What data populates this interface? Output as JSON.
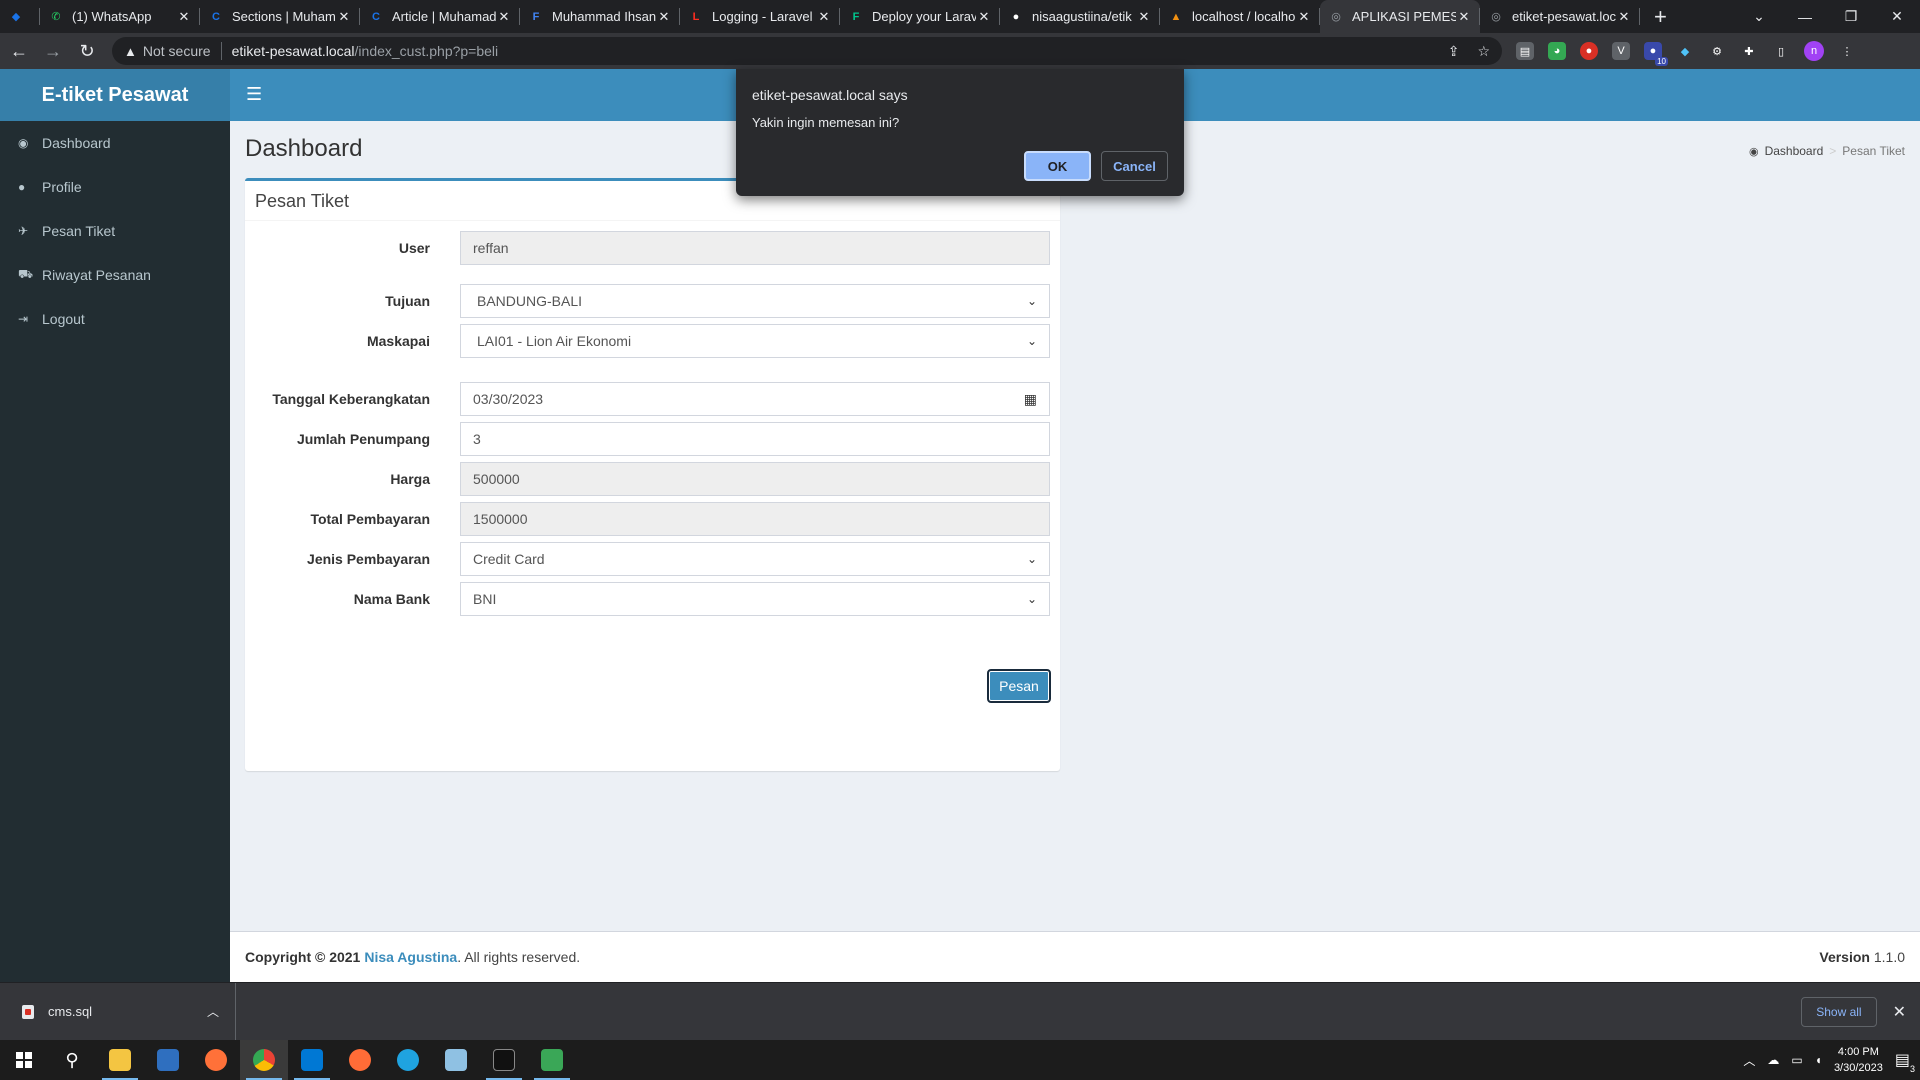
{
  "browser": {
    "tabs": [
      {
        "title": "",
        "color": "#1a73e8",
        "glyph": "◆"
      },
      {
        "title": "(1) WhatsApp",
        "color": "#25d366",
        "glyph": "✆"
      },
      {
        "title": "Sections | Muham",
        "color": "#1a73e8",
        "glyph": "C"
      },
      {
        "title": "Article | Muhamad",
        "color": "#1a73e8",
        "glyph": "C"
      },
      {
        "title": "Muhammad Ihsan",
        "color": "#4285f4",
        "glyph": "F"
      },
      {
        "title": "Logging - Laravel",
        "color": "#ff2d20",
        "glyph": "L"
      },
      {
        "title": "Deploy your Larav",
        "color": "#00c58e",
        "glyph": "F"
      },
      {
        "title": "nisaagustiina/etik",
        "color": "#ffffff",
        "glyph": "●"
      },
      {
        "title": "localhost / localho",
        "color": "#f29111",
        "glyph": "▲"
      },
      {
        "title": "APLIKASI PEMESA",
        "color": "#9aa0a6",
        "glyph": "◎"
      },
      {
        "title": "etiket-pesawat.loc",
        "color": "#9aa0a6",
        "glyph": "◎"
      }
    ],
    "active_tab_index": 9,
    "address": {
      "security": "Not secure",
      "host": "etiket-pesawat.local",
      "path": "/index_cust.php?p=beli"
    },
    "extension_badge": "10",
    "profile_initial": "n"
  },
  "app": {
    "brand": "E-tiket Pesawat",
    "sidebar": [
      {
        "label": "Dashboard",
        "icon": "dashboard-icon",
        "glyph": "◉"
      },
      {
        "label": "Profile",
        "icon": "user-icon",
        "glyph": "●"
      },
      {
        "label": "Pesan Tiket",
        "icon": "plane-icon",
        "glyph": "✈"
      },
      {
        "label": "Riwayat Pesanan",
        "icon": "cart-icon",
        "glyph": "⛟"
      },
      {
        "label": "Logout",
        "icon": "logout-icon",
        "glyph": "⇥"
      }
    ],
    "page_title": "Dashboard",
    "breadcrumb": {
      "home": "Dashboard",
      "separator": ">",
      "current": "Pesan Tiket"
    },
    "form": {
      "title": "Pesan Tiket",
      "fields": {
        "user": {
          "label": "User",
          "value": "reffan"
        },
        "tujuan": {
          "label": "Tujuan",
          "value": "BANDUNG-BALI"
        },
        "maskapai": {
          "label": "Maskapai",
          "value": "LAI01 - Lion Air Ekonomi"
        },
        "tanggal": {
          "label": "Tanggal Keberangkatan",
          "value": "03/30/2023"
        },
        "jumlah": {
          "label": "Jumlah Penumpang",
          "value": "3"
        },
        "harga": {
          "label": "Harga",
          "value": "500000"
        },
        "total": {
          "label": "Total Pembayaran",
          "value": "1500000"
        },
        "jenis": {
          "label": "Jenis Pembayaran",
          "value": "Credit Card"
        },
        "bank": {
          "label": "Nama Bank",
          "value": "BNI"
        }
      },
      "submit_label": "Pesan"
    },
    "footer": {
      "copyright": "Copyright © 2021",
      "author": "Nisa Agustina",
      "rights": ". All rights reserved.",
      "version_label": "Version",
      "version": "1.1.0"
    }
  },
  "dialog": {
    "title": "etiket-pesawat.local says",
    "message": "Yakin ingin memesan ini?",
    "ok_label": "OK",
    "cancel_label": "Cancel"
  },
  "downloads": {
    "file": "cms.sql",
    "show_all": "Show all"
  },
  "taskbar": {
    "time": "4:00 PM",
    "date": "3/30/2023",
    "notification_count": "3"
  },
  "colors": {
    "primary": "#3c8dbc",
    "logo_bg": "#367fa9",
    "sidebar_bg": "#222d32"
  }
}
